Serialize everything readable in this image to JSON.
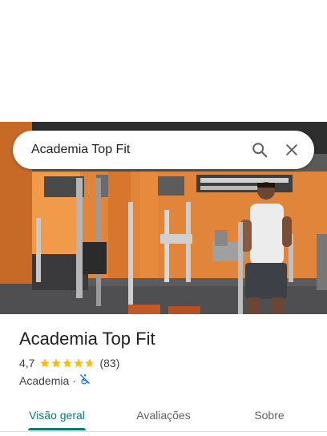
{
  "search": {
    "query": "Academia Top Fit",
    "search_icon": "search-icon",
    "close_icon": "close-icon"
  },
  "place": {
    "name": "Academia Top Fit",
    "rating": "4,7",
    "rating_value": 4.7,
    "stars_max": 5,
    "review_count": "(83)",
    "category": "Academia",
    "separator": "·",
    "accessibility_icon": "not-wheelchair-accessible-icon"
  },
  "tabs": [
    {
      "label": "Visão geral",
      "active": true
    },
    {
      "label": "Avaliações",
      "active": false
    },
    {
      "label": "Sobre",
      "active": false
    }
  ],
  "colors": {
    "accent": "#0b7a6e",
    "star": "#fbbc04",
    "accessibility_icon": "#1a73e8"
  }
}
